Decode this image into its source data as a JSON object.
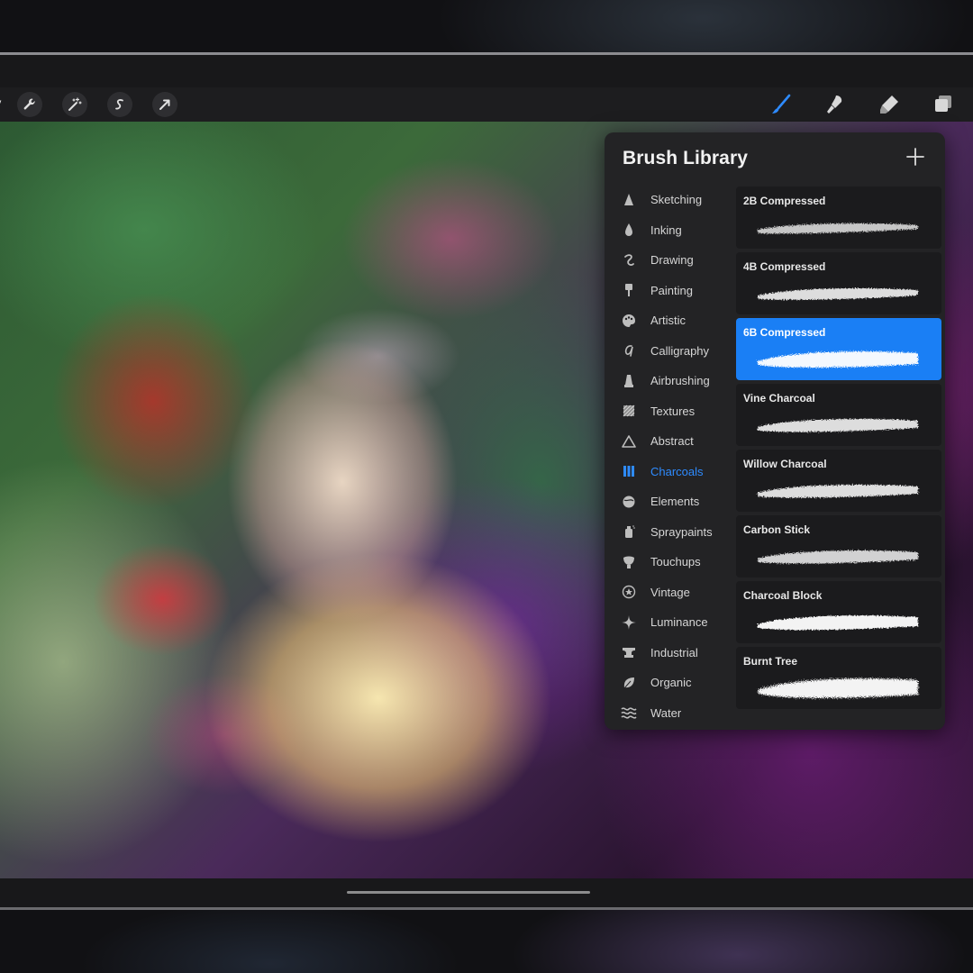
{
  "toolbar": {
    "gallery_label": "ry",
    "left_tools": [
      {
        "icon": "wrench-icon"
      },
      {
        "icon": "magic-wand-icon"
      },
      {
        "icon": "selection-icon"
      },
      {
        "icon": "transform-arrow-icon"
      }
    ],
    "right_tools": [
      {
        "icon": "brush-icon",
        "active": true
      },
      {
        "icon": "smudge-icon"
      },
      {
        "icon": "eraser-icon"
      },
      {
        "icon": "layers-icon"
      }
    ]
  },
  "panel": {
    "title": "Brush Library",
    "add_icon": "plus-icon",
    "categories": [
      {
        "label": "Sketching",
        "icon": "sketching-icon"
      },
      {
        "label": "Inking",
        "icon": "inking-icon"
      },
      {
        "label": "Drawing",
        "icon": "drawing-icon"
      },
      {
        "label": "Painting",
        "icon": "painting-icon"
      },
      {
        "label": "Artistic",
        "icon": "palette-icon"
      },
      {
        "label": "Calligraphy",
        "icon": "calligraphy-icon"
      },
      {
        "label": "Airbrushing",
        "icon": "airbrush-icon"
      },
      {
        "label": "Textures",
        "icon": "textures-icon"
      },
      {
        "label": "Abstract",
        "icon": "abstract-icon"
      },
      {
        "label": "Charcoals",
        "icon": "charcoals-icon",
        "active": true
      },
      {
        "label": "Elements",
        "icon": "elements-icon"
      },
      {
        "label": "Spraypaints",
        "icon": "spraypaint-icon"
      },
      {
        "label": "Touchups",
        "icon": "touchups-icon"
      },
      {
        "label": "Vintage",
        "icon": "vintage-star-icon"
      },
      {
        "label": "Luminance",
        "icon": "luminance-icon"
      },
      {
        "label": "Industrial",
        "icon": "anvil-icon"
      },
      {
        "label": "Organic",
        "icon": "leaf-icon"
      },
      {
        "label": "Water",
        "icon": "water-icon"
      }
    ],
    "brushes": [
      {
        "name": "2B Compressed"
      },
      {
        "name": "4B Compressed"
      },
      {
        "name": "6B Compressed",
        "selected": true
      },
      {
        "name": "Vine Charcoal"
      },
      {
        "name": "Willow Charcoal"
      },
      {
        "name": "Carbon Stick"
      },
      {
        "name": "Charcoal Block"
      },
      {
        "name": "Burnt Tree"
      }
    ]
  },
  "colors": {
    "accent": "#1a7ff5",
    "panel_bg": "#232325",
    "toolbar_bg": "#1d1d1f"
  }
}
